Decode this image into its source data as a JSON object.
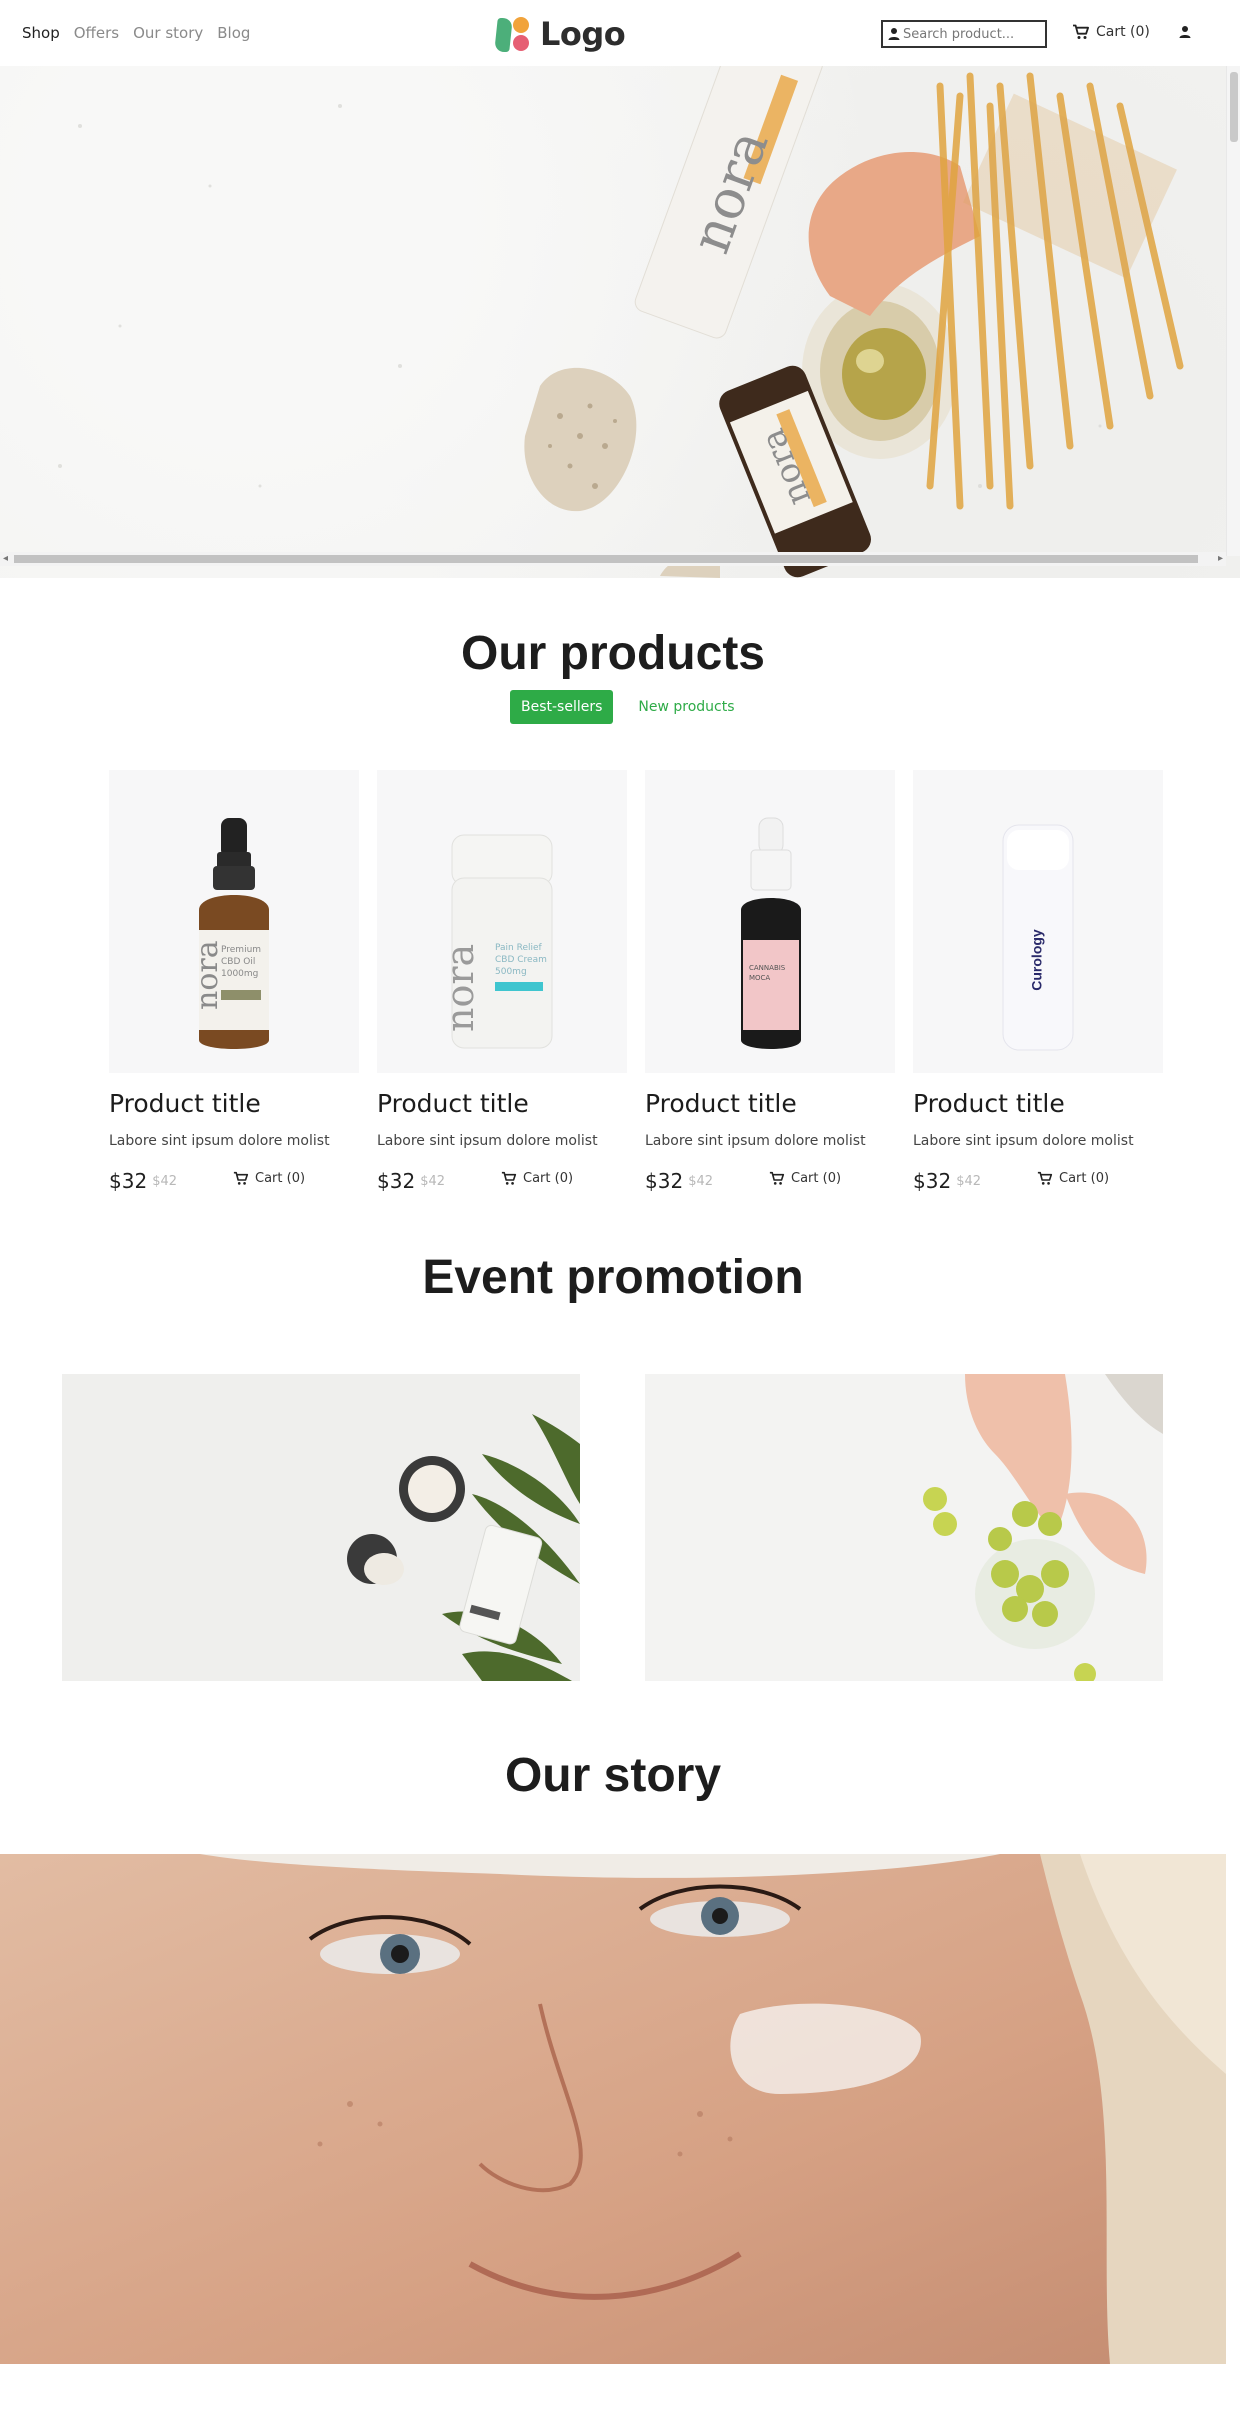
{
  "nav": {
    "links": [
      {
        "label": "Shop",
        "active": true
      },
      {
        "label": "Offers",
        "active": false
      },
      {
        "label": "Our story",
        "active": false
      },
      {
        "label": "Blog",
        "active": false
      }
    ],
    "logo_text": "Logo",
    "search_placeholder": "Search product...",
    "cart_label": "Cart (0)",
    "user_icon": "user-icon"
  },
  "products_section": {
    "title": "Our products",
    "tabs": [
      {
        "label": "Best-sellers",
        "active": true
      },
      {
        "label": "New products",
        "active": false
      }
    ],
    "items": [
      {
        "title": "Product title",
        "description": "Labore sint ipsum dolore molist",
        "price": "$32",
        "old_price": "$42",
        "cart_label": "Cart (0)"
      },
      {
        "title": "Product title",
        "description": "Labore sint ipsum dolore molist",
        "price": "$32",
        "old_price": "$42",
        "cart_label": "Cart (0)"
      },
      {
        "title": "Product title",
        "description": "Labore sint ipsum dolore molist",
        "price": "$32",
        "old_price": "$42",
        "cart_label": "Cart (0)"
      },
      {
        "title": "Product title",
        "description": "Labore sint ipsum dolore molist",
        "price": "$32",
        "old_price": "$42",
        "cart_label": "Cart (0)"
      }
    ]
  },
  "event_section": {
    "title": "Event promotion"
  },
  "story_section": {
    "title": "Our story"
  },
  "colors": {
    "accent_green": "#2eab47",
    "logo_green": "#4caf7a",
    "logo_orange": "#f1a33b",
    "logo_pink": "#e65f73"
  }
}
